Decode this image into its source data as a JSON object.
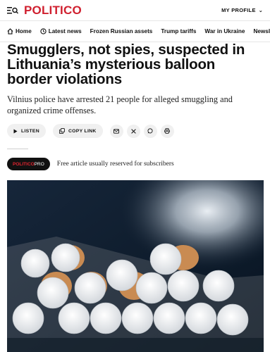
{
  "header": {
    "logo": "POLITICO",
    "profile_label": "MY PROFILE",
    "brand_color": "#d0202f"
  },
  "nav": {
    "items": [
      {
        "label": "Home",
        "icon": "home-icon"
      },
      {
        "label": "Latest news",
        "icon": "clock-icon"
      },
      {
        "label": "Frozen Russian assets"
      },
      {
        "label": "Trump tariffs"
      },
      {
        "label": "War in Ukraine"
      },
      {
        "label": "Newsletters"
      }
    ]
  },
  "article": {
    "headline": "Smugglers, not spies, suspected in Lithuania’s mysterious balloon border violations",
    "dek": "Vilnius police have arrested 21 people for alleged smuggling and organized crime offenses.",
    "listen_label": "LISTEN",
    "copy_link_label": "COPY LINK",
    "share_icons": [
      "mail-icon",
      "x-icon",
      "whatsapp-icon",
      "print-icon"
    ],
    "pro_badge_part1": "POLITICO",
    "pro_badge_part2": "PRO",
    "pro_note": "Free article usually reserved for subscribers",
    "image_subject": "cigarettes-in-pack"
  }
}
